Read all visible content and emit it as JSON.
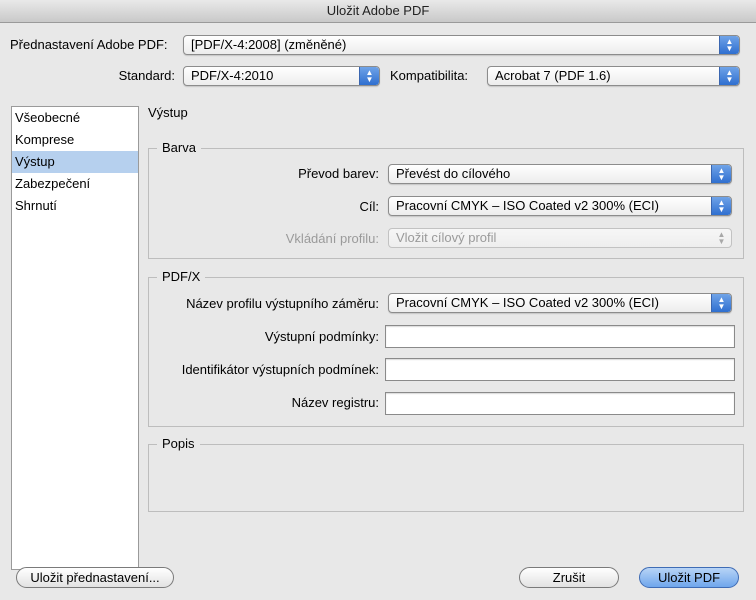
{
  "window": {
    "title": "Uložit Adobe PDF"
  },
  "preset": {
    "label": "Přednastavení Adobe PDF:",
    "value": "[PDF/X-4:2008] (změněné)"
  },
  "standard": {
    "label": "Standard:",
    "value": "PDF/X-4:2010"
  },
  "compatibility": {
    "label": "Kompatibilita:",
    "value": "Acrobat 7 (PDF 1.6)"
  },
  "sidebar": {
    "items": [
      {
        "label": "Všeobecné"
      },
      {
        "label": "Komprese"
      },
      {
        "label": "Výstup"
      },
      {
        "label": "Zabezpečení"
      },
      {
        "label": "Shrnutí"
      }
    ],
    "selected": "Výstup"
  },
  "panel": {
    "title": "Výstup",
    "color_group": {
      "title": "Barva",
      "conversion": {
        "label": "Převod barev:",
        "value": "Převést do cílového"
      },
      "destination": {
        "label": "Cíl:",
        "value": "Pracovní CMYK – ISO Coated v2 300% (ECI)"
      },
      "profile_inclusion": {
        "label": "Vkládání profilu:",
        "value": "Vložit cílový profil"
      }
    },
    "pdfx_group": {
      "title": "PDF/X",
      "output_intent_profile": {
        "label": "Název profilu výstupního záměru:",
        "value": "Pracovní CMYK – ISO Coated v2 300% (ECI)"
      },
      "output_condition": {
        "label": "Výstupní podmínky:",
        "value": ""
      },
      "output_condition_id": {
        "label": "Identifikátor výstupních podmínek:",
        "value": ""
      },
      "registry_name": {
        "label": "Název registru:",
        "value": ""
      }
    },
    "description_group": {
      "title": "Popis"
    }
  },
  "buttons": {
    "save_preset": "Uložit přednastavení...",
    "cancel": "Zrušit",
    "save_pdf": "Uložit PDF"
  },
  "icons": {
    "popup_arrows": "updown-arrows-icon"
  },
  "colors": {
    "accent": "#3f7fd9",
    "selection": "#b6d0ee"
  }
}
